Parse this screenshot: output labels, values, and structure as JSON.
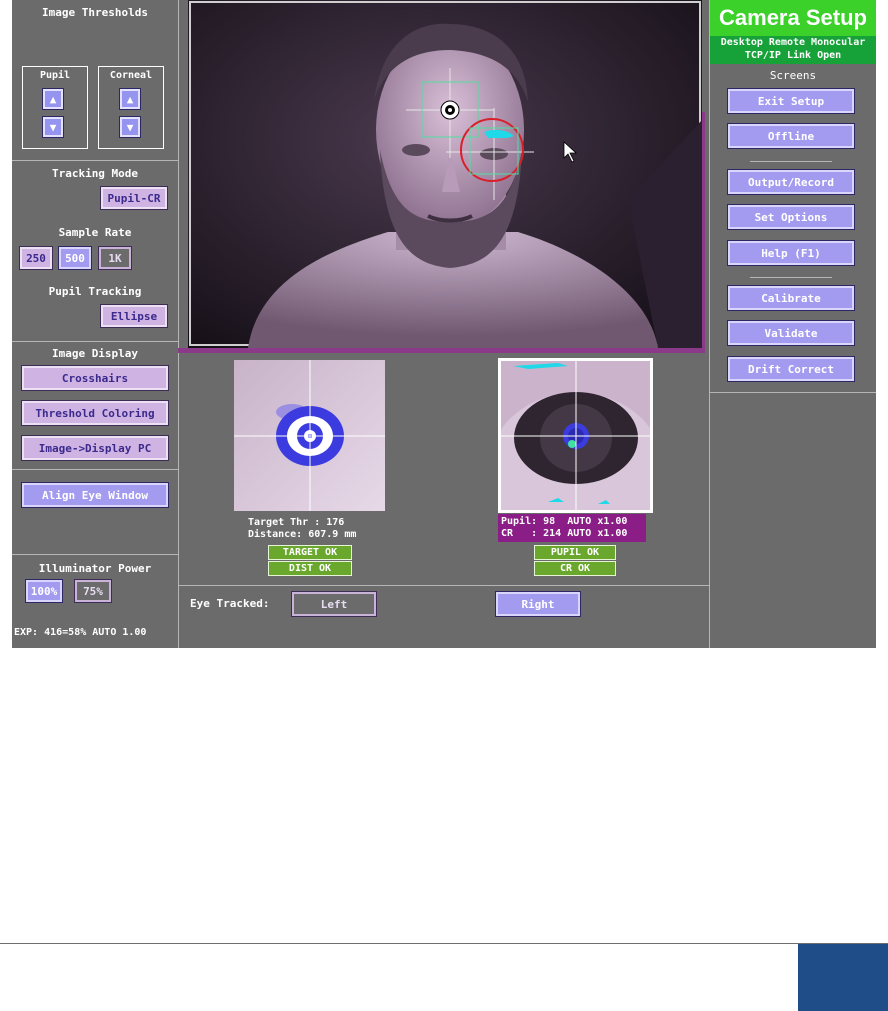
{
  "left_panel": {
    "image_thresholds_title": "Image Thresholds",
    "pupil_label": "Pupil",
    "corneal_label": "Corneal",
    "tracking_mode_title": "Tracking Mode",
    "tracking_mode_value": "Pupil-CR",
    "sample_rate_title": "Sample Rate",
    "sample_rates": [
      "250",
      "500",
      "1K"
    ],
    "sample_rate_selected": "500",
    "pupil_tracking_title": "Pupil Tracking",
    "pupil_tracking_value": "Ellipse",
    "image_display_title": "Image Display",
    "crosshairs_label": "Crosshairs",
    "threshold_coloring_label": "Threshold Coloring",
    "image_display_pc_label": "Image->Display PC",
    "align_eye_window_label": "Align Eye Window",
    "illuminator_power_title": "Illuminator Power",
    "illuminator_options": [
      "100%",
      "75%"
    ],
    "illuminator_selected": "100%",
    "exposure_text": "EXP: 416=58% AUTO 1.00"
  },
  "right_panel": {
    "title": "Camera Setup",
    "mode_line1": "Desktop Remote Monocular",
    "mode_line2": "TCP/IP Link Open",
    "screens_label": "Screens",
    "buttons": {
      "exit_setup": "Exit Setup",
      "offline": "Offline",
      "output_record": "Output/Record",
      "set_options": "Set Options",
      "help": "Help (F1)",
      "calibrate": "Calibrate",
      "validate": "Validate",
      "drift_correct": "Drift Correct"
    }
  },
  "target_view": {
    "line1": "Target Thr : 176",
    "line2": "Distance: 607.9 mm",
    "status1": "TARGET OK",
    "status2": "DIST  OK"
  },
  "eye_view": {
    "line1": "Pupil: 98  AUTO x1.00",
    "line2": "CR   : 214 AUTO x1.00",
    "status1": "PUPIL OK",
    "status2": "CR  OK"
  },
  "eye_tracked": {
    "label": "Eye Tracked:",
    "left": "Left",
    "right": "Right",
    "selected": "Right"
  },
  "colors": {
    "header_green": "#3bd12a",
    "status_green": "#6aa82d",
    "info_magenta": "#8b1e86",
    "button_lavender": "#cfb3e3",
    "button_selected": "#a39bef",
    "footer_blue": "#1f4d87"
  }
}
